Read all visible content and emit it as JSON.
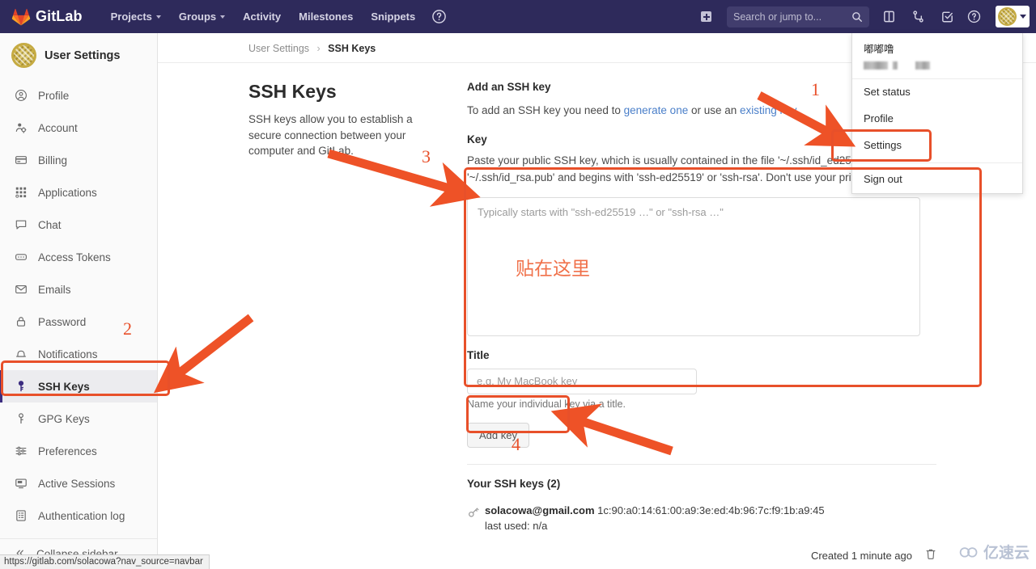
{
  "navbar": {
    "brand": "GitLab",
    "items": [
      {
        "label": "Projects",
        "has_caret": true
      },
      {
        "label": "Groups",
        "has_caret": true
      },
      {
        "label": "Activity",
        "has_caret": false
      },
      {
        "label": "Milestones",
        "has_caret": false
      },
      {
        "label": "Snippets",
        "has_caret": false
      }
    ],
    "help_icon": "question-circle-icon",
    "new_icon": "plus-square-icon",
    "search_placeholder": "Search or jump to...",
    "search_icon": "search-icon",
    "icons": [
      "todos-icon",
      "merge-requests-icon",
      "issues-icon"
    ],
    "help_caret_icon": "chevron-down-icon",
    "avatar_icon": "user-avatar"
  },
  "user_dropdown": {
    "name": "嘟嘟噜",
    "handle_redacted": true,
    "items": [
      {
        "label": "Set status"
      },
      {
        "label": "Profile"
      },
      {
        "label": "Settings"
      },
      {
        "label": "Sign out"
      }
    ]
  },
  "sidebar": {
    "title": "User Settings",
    "items": [
      {
        "label": "Profile",
        "icon": "user-icon",
        "active": false
      },
      {
        "label": "Account",
        "icon": "account-gear-icon",
        "active": false
      },
      {
        "label": "Billing",
        "icon": "credit-card-icon",
        "active": false
      },
      {
        "label": "Applications",
        "icon": "grid-apps-icon",
        "active": false
      },
      {
        "label": "Chat",
        "icon": "chat-bubble-icon",
        "active": false
      },
      {
        "label": "Access Tokens",
        "icon": "token-icon",
        "active": false
      },
      {
        "label": "Emails",
        "icon": "envelope-icon",
        "active": false
      },
      {
        "label": "Password",
        "icon": "lock-icon",
        "active": false
      },
      {
        "label": "Notifications",
        "icon": "bell-icon",
        "active": false
      },
      {
        "label": "SSH Keys",
        "icon": "key-icon",
        "active": true
      },
      {
        "label": "GPG Keys",
        "icon": "gpg-key-icon",
        "active": false
      },
      {
        "label": "Preferences",
        "icon": "sliders-icon",
        "active": false
      },
      {
        "label": "Active Sessions",
        "icon": "monitor-icon",
        "active": false
      },
      {
        "label": "Authentication log",
        "icon": "log-book-icon",
        "active": false
      }
    ],
    "collapse_label": "Collapse sidebar",
    "collapse_icon": "chevron-double-left-icon"
  },
  "breadcrumb": {
    "parent": "User Settings",
    "separator": "›",
    "current": "SSH Keys"
  },
  "page": {
    "title": "SSH Keys",
    "description": "SSH keys allow you to establish a secure connection between your computer and GitLab."
  },
  "form": {
    "section_title": "Add an SSH key",
    "intro_pre": "To add an SSH key you need to ",
    "intro_link1": "generate one",
    "intro_mid": " or use an ",
    "intro_link2": "existing key",
    "intro_post": ".",
    "key_label": "Key",
    "key_help": "Paste your public SSH key, which is usually contained in the file '~/.ssh/id_ed25519.pub' or '~/.ssh/id_rsa.pub' and begins with 'ssh-ed25519' or 'ssh-rsa'. Don't use your private SSH key.",
    "key_placeholder": "Typically starts with \"ssh-ed25519 …\" or \"ssh-rsa …\"",
    "key_value": "",
    "title_label": "Title",
    "title_placeholder": "e.g. My MacBook key",
    "title_value": "",
    "title_help": "Name your individual key via a title.",
    "submit_label": "Add key"
  },
  "keys_list": {
    "heading": "Your SSH keys (2)",
    "key_icon": "key-icon",
    "delete_icon": "trash-icon",
    "rows": [
      {
        "title": "solacowa@gmail.com",
        "fingerprint": "1c:90:a0:14:61:00:a9:3e:ed:4b:96:7c:f9:1b:a9:45",
        "last_used": "last used: n/a",
        "created": "Created 1 minute ago"
      }
    ]
  },
  "annotations": {
    "note_paste_here": "贴在这里",
    "numbers": [
      "1",
      "2",
      "3",
      "4"
    ]
  },
  "statusbar": {
    "url": "https://gitlab.com/solacowa?nav_source=navbar"
  },
  "watermark": {
    "text": "亿速云"
  },
  "colors": {
    "navbar_bg": "#2e2a5b",
    "accent_orange": "#e8502a",
    "link_blue": "#4a7fc9",
    "sidebar_active": "#3c2d80"
  }
}
